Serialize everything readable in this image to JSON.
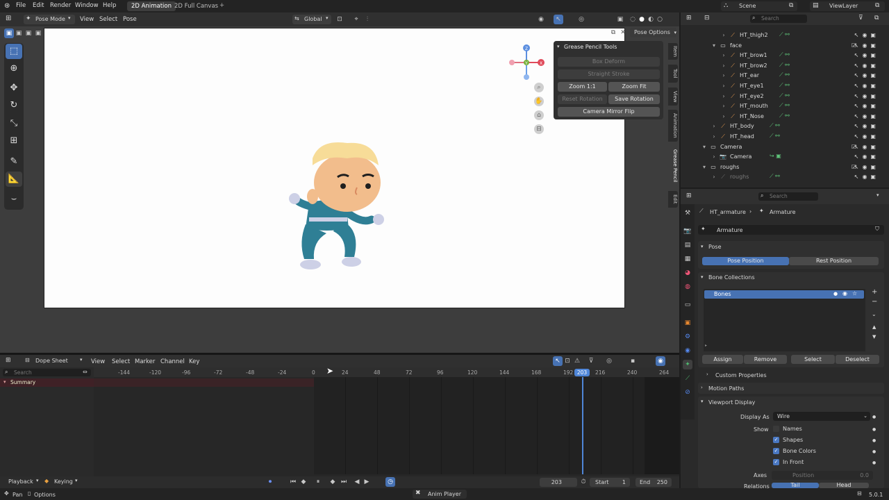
{
  "topbar": {
    "menus": [
      "File",
      "Edit",
      "Render",
      "Window",
      "Help"
    ],
    "workspace_tabs": [
      "2D Animation",
      "2D Full Canvas"
    ],
    "add_tab": "+",
    "scene": "Scene",
    "view_layer": "ViewLayer"
  },
  "viewport": {
    "mode": "Pose Mode",
    "menus": [
      "View",
      "Select",
      "Pose"
    ],
    "orientation": "Global",
    "pose_options": "Pose Options",
    "gizmo": {
      "z": "Z",
      "y": "Y",
      "x": "X"
    }
  },
  "gp_tools": {
    "title": "Grease Pencil Tools",
    "box_deform": "Box Deform",
    "straight_stroke": "Straight Stroke",
    "zoom_11": "Zoom 1:1",
    "zoom_fit": "Zoom Fit",
    "reset_rotation": "Reset Rotation",
    "save_rotation": "Save Rotation",
    "mirror_flip": "Camera Mirror Flip"
  },
  "sidebar_tabs": [
    "Item",
    "Tool",
    "View",
    "Animation",
    "Grease Pencil",
    "Edit"
  ],
  "outliner": {
    "search_placeholder": "Search",
    "rows": [
      {
        "indent": 3,
        "label": "HT_thigh2",
        "type": "bone"
      },
      {
        "indent": 2,
        "label": "face",
        "type": "collection"
      },
      {
        "indent": 3,
        "label": "HT_brow1",
        "type": "bone"
      },
      {
        "indent": 3,
        "label": "HT_brow2",
        "type": "bone"
      },
      {
        "indent": 3,
        "label": "HT_ear",
        "type": "bone"
      },
      {
        "indent": 3,
        "label": "HT_eye1",
        "type": "bone"
      },
      {
        "indent": 3,
        "label": "HT_eye2",
        "type": "bone"
      },
      {
        "indent": 3,
        "label": "HT_mouth",
        "type": "bone"
      },
      {
        "indent": 3,
        "label": "HT_Nose",
        "type": "bone"
      },
      {
        "indent": 2,
        "label": "HT_body",
        "type": "bone"
      },
      {
        "indent": 2,
        "label": "HT_head",
        "type": "bone"
      },
      {
        "indent": 1,
        "label": "Camera",
        "type": "collection"
      },
      {
        "indent": 2,
        "label": "Camera",
        "type": "camera"
      },
      {
        "indent": 1,
        "label": "roughs",
        "type": "collection"
      },
      {
        "indent": 2,
        "label": "roughs",
        "type": "dim"
      }
    ]
  },
  "properties": {
    "search_placeholder": "Search",
    "breadcrumb_object": "HT_armature",
    "breadcrumb_data": "Armature",
    "data_name": "Armature",
    "pose_section": "Pose",
    "pose_position": "Pose Position",
    "rest_position": "Rest Position",
    "bone_collections": "Bone Collections",
    "bones_item": "Bones",
    "assign": "Assign",
    "remove": "Remove",
    "select": "Select",
    "deselect": "Deselect",
    "custom_properties": "Custom Properties",
    "motion_paths": "Motion Paths",
    "viewport_display": "Viewport Display",
    "display_as_label": "Display As",
    "display_as_value": "Wire",
    "show_label": "Show",
    "names": "Names",
    "shapes": "Shapes",
    "bone_colors": "Bone Colors",
    "in_front": "In Front",
    "axes_label": "Axes",
    "position_label": "Position",
    "position_value": "0.0",
    "relations_label": "Relations",
    "tail": "Tail",
    "head": "Head"
  },
  "dopesheet": {
    "editor": "Dope Sheet",
    "menus": [
      "View",
      "Select",
      "Marker",
      "Channel",
      "Key"
    ],
    "search_placeholder": "Search",
    "summary": "Summary",
    "ticks": [
      "-144",
      "-120",
      "-96",
      "-72",
      "-48",
      "-24",
      "0",
      "24",
      "48",
      "72",
      "96",
      "120",
      "144",
      "168",
      "192",
      "216",
      "240",
      "264"
    ],
    "current_frame": "203"
  },
  "playback": {
    "playback": "Playback",
    "keying": "Keying",
    "frame": "203",
    "start_label": "Start",
    "start_value": "1",
    "end_label": "End",
    "end_value": "250"
  },
  "statusbar": {
    "pan": "Pan",
    "options": "Options",
    "anim_player": "Anim Player",
    "version": "5.0.1"
  }
}
